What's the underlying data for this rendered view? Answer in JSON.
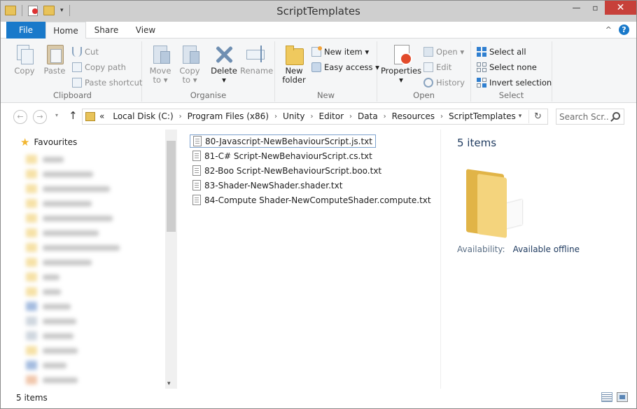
{
  "window": {
    "title": "ScriptTemplates",
    "minimize_glyph": "—",
    "maximize_glyph": "▫",
    "close_glyph": "✕"
  },
  "qat": {
    "dropdown_glyph": "▾"
  },
  "ribbon_tabs": {
    "file": "File",
    "home": "Home",
    "share": "Share",
    "view": "View",
    "collapse_glyph": "^",
    "help_glyph": "?"
  },
  "ribbon": {
    "clipboard": {
      "label": "Clipboard",
      "copy": "Copy",
      "paste": "Paste",
      "cut": "Cut",
      "copy_path": "Copy path",
      "paste_shortcut": "Paste shortcut"
    },
    "organise": {
      "label": "Organise",
      "move_to_line1": "Move",
      "move_to_line2": "to ▾",
      "copy_to_line1": "Copy",
      "copy_to_line2": "to ▾",
      "delete": "Delete",
      "delete_arrow": "▾",
      "rename": "Rename"
    },
    "new": {
      "label": "New",
      "new_folder_line1": "New",
      "new_folder_line2": "folder",
      "new_item": "New item ▾",
      "easy_access": "Easy access ▾"
    },
    "open": {
      "label": "Open",
      "properties": "Properties",
      "properties_arrow": "▾",
      "open": "Open ▾",
      "edit": "Edit",
      "history": "History"
    },
    "select": {
      "label": "Select",
      "select_all": "Select all",
      "select_none": "Select none",
      "invert_selection": "Invert selection"
    }
  },
  "navigation": {
    "back_glyph": "←",
    "forward_glyph": "→",
    "recent_glyph": "▾",
    "up_glyph": "↑",
    "overflow": "«",
    "breadcrumbs": [
      "Local Disk (C:)",
      "Program Files (x86)",
      "Unity",
      "Editor",
      "Data",
      "Resources",
      "ScriptTemplates"
    ],
    "breadcrumb_separator": "›",
    "address_dropdown_glyph": "▾",
    "refresh_glyph": "↻",
    "search_placeholder": "Search Scr..."
  },
  "nav_pane": {
    "favourites": "Favourites",
    "scroll_down_glyph": "▾"
  },
  "files": [
    {
      "name": "80-Javascript-NewBehaviourScript.js.txt",
      "selected": true
    },
    {
      "name": "81-C# Script-NewBehaviourScript.cs.txt",
      "selected": false
    },
    {
      "name": "82-Boo Script-NewBehaviourScript.boo.txt",
      "selected": false
    },
    {
      "name": "83-Shader-NewShader.shader.txt",
      "selected": false
    },
    {
      "name": "84-Compute Shader-NewComputeShader.compute.txt",
      "selected": false
    }
  ],
  "details": {
    "items_count": "5 items",
    "availability_label": "Availability:",
    "availability_value": "Available offline"
  },
  "status": {
    "text": "5 items"
  },
  "colors": {
    "accent": "#1979ca",
    "close": "#c7403a",
    "folder": "#efc95e"
  }
}
